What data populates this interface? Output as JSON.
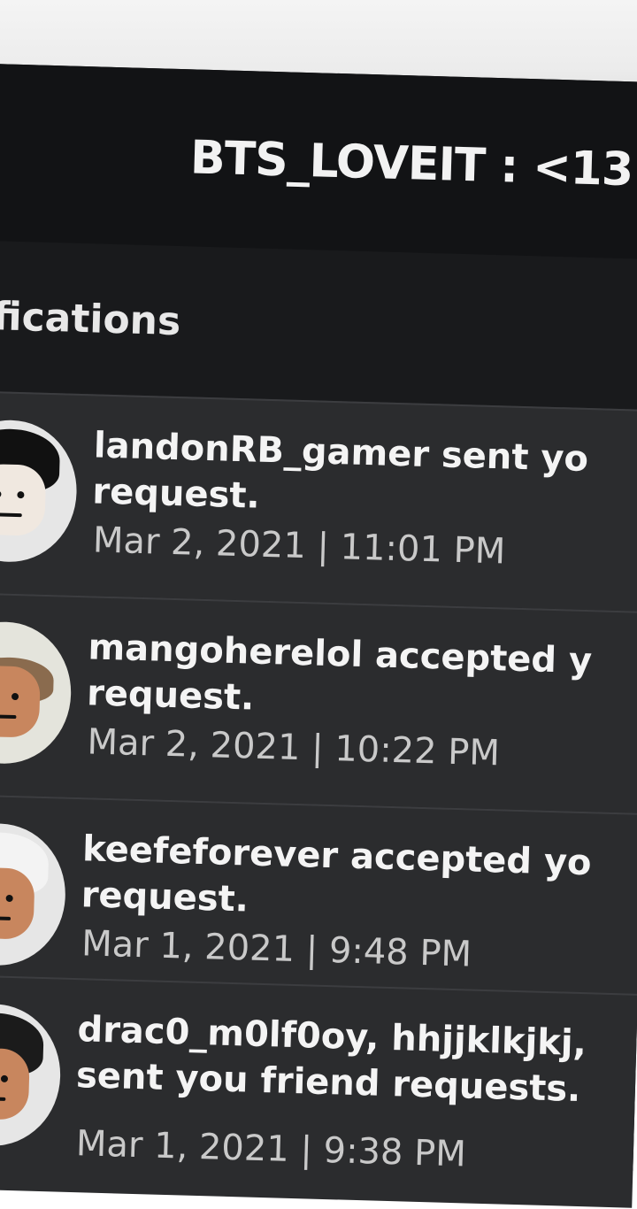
{
  "header": {
    "username": "BTS_LOVEIT : <13"
  },
  "section": {
    "title": "fications"
  },
  "notifications": [
    {
      "text": "landonRB_gamer sent yo request.",
      "time": "Mar 2, 2021 | 11:01 PM",
      "avatar_icon": "avatar-boy-dark-hair"
    },
    {
      "text": "mangoherelol accepted y request.",
      "time": "Mar 2, 2021 | 10:22 PM",
      "avatar_icon": "avatar-girl-brown-hair"
    },
    {
      "text": "keefeforever accepted yo request.",
      "time": "Mar 1, 2021 | 9:48 PM",
      "avatar_icon": "avatar-white-hat"
    },
    {
      "text": "drac0_m0lf0oy, hhjjklkjkj, sent you friend requests.",
      "time": "Mar 1, 2021 | 9:38 PM",
      "avatar_icon": "avatar-dark-hair-smile"
    }
  ]
}
